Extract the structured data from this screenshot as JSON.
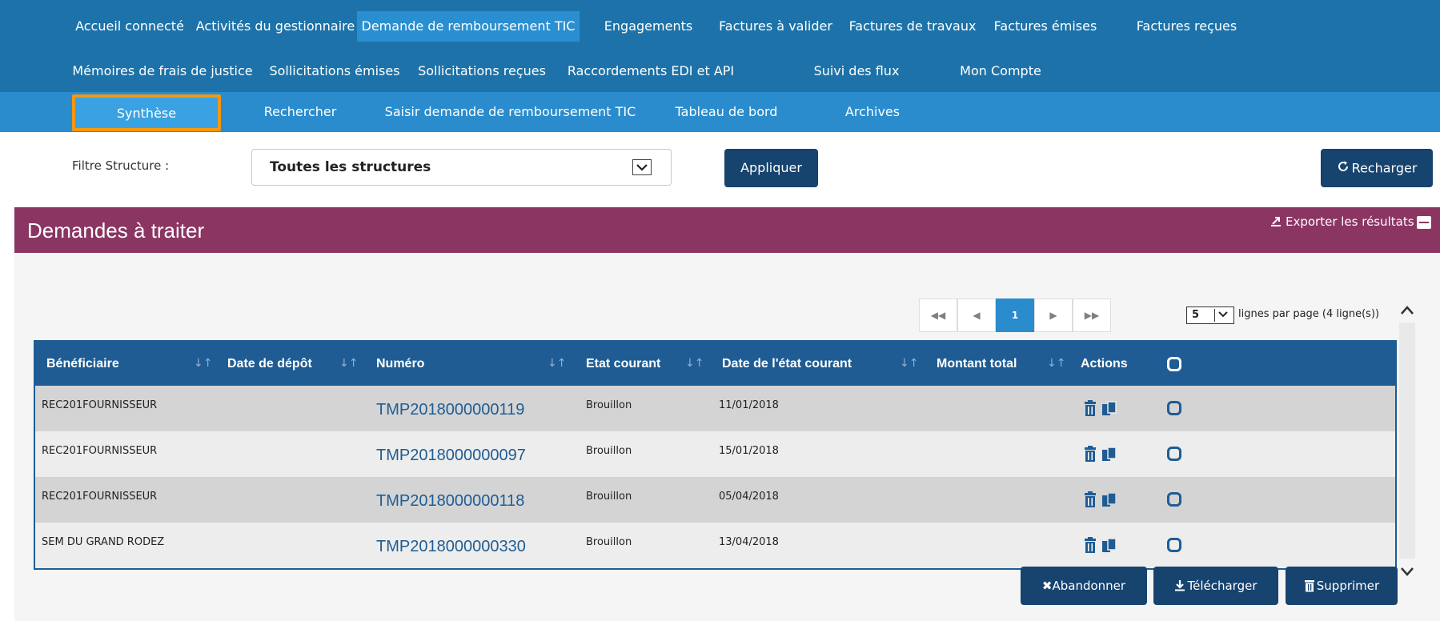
{
  "top_nav": {
    "row1": [
      {
        "label": "Accueil connecté",
        "active": false
      },
      {
        "label": "Activités du gestionnaire",
        "active": false
      },
      {
        "label": "Demande de remboursement TIC",
        "active": true
      },
      {
        "label": "Engagements",
        "active": false
      },
      {
        "label": "Factures à valider",
        "active": false
      },
      {
        "label": "Factures de travaux",
        "active": false
      },
      {
        "label": "Factures émises",
        "active": false
      },
      {
        "label": "Factures reçues",
        "active": false
      }
    ],
    "row2": [
      {
        "label": "Mémoires de frais de justice"
      },
      {
        "label": "Sollicitations émises"
      },
      {
        "label": "Sollicitations reçues"
      },
      {
        "label": "Raccordements EDI et API"
      },
      {
        "label": "Suivi des flux"
      },
      {
        "label": "Mon Compte"
      }
    ]
  },
  "sub_nav": [
    {
      "label": "Synthèse",
      "active": true
    },
    {
      "label": "Rechercher",
      "active": false
    },
    {
      "label": "Saisir demande de remboursement TIC",
      "active": false
    },
    {
      "label": "Tableau de bord",
      "active": false
    },
    {
      "label": "Archives",
      "active": false
    }
  ],
  "filter": {
    "label": "Filtre Structure :",
    "value": "Toutes les structures",
    "apply_label": "Appliquer",
    "reload_label": "Recharger"
  },
  "panel": {
    "title": "Demandes à traiter",
    "export_label": "Exporter les résultats"
  },
  "pagination": {
    "current_page": "1",
    "page_size": "5",
    "info": "lignes par page (4 ligne(s))"
  },
  "table": {
    "columns": [
      "Bénéficiaire",
      "Date de dépôt",
      "Numéro",
      "Etat courant",
      "Date de l'état courant",
      "Montant total",
      "Actions"
    ],
    "rows": [
      {
        "beneficiaire": "REC201FOURNISSEUR",
        "date_depot": "",
        "numero": "TMP2018000000119",
        "etat": "Brouillon",
        "date_etat": "11/01/2018",
        "montant": ""
      },
      {
        "beneficiaire": "REC201FOURNISSEUR",
        "date_depot": "",
        "numero": "TMP2018000000097",
        "etat": "Brouillon",
        "date_etat": "15/01/2018",
        "montant": ""
      },
      {
        "beneficiaire": "REC201FOURNISSEUR",
        "date_depot": "",
        "numero": "TMP2018000000118",
        "etat": "Brouillon",
        "date_etat": "05/04/2018",
        "montant": ""
      },
      {
        "beneficiaire": "SEM DU GRAND RODEZ",
        "date_depot": "",
        "numero": "TMP2018000000330",
        "etat": "Brouillon",
        "date_etat": "13/04/2018",
        "montant": ""
      }
    ]
  },
  "actions": {
    "abandon_label": "Abandonner",
    "download_label": "Télécharger",
    "delete_label": "Supprimer"
  },
  "icons": [
    "refresh-icon",
    "export-icon",
    "collapse-icon",
    "trash-icon",
    "copy-icon",
    "checkbox-icon",
    "first-page-icon",
    "prev-page-icon",
    "next-page-icon",
    "last-page-icon",
    "close-icon",
    "download-icon"
  ],
  "colors": {
    "nav": "#1d73a9",
    "subnav": "#2a8ccd",
    "highlight": "#f39813",
    "panel_header": "#8b3563",
    "table_header": "#1f5c93",
    "button": "#17436f"
  }
}
